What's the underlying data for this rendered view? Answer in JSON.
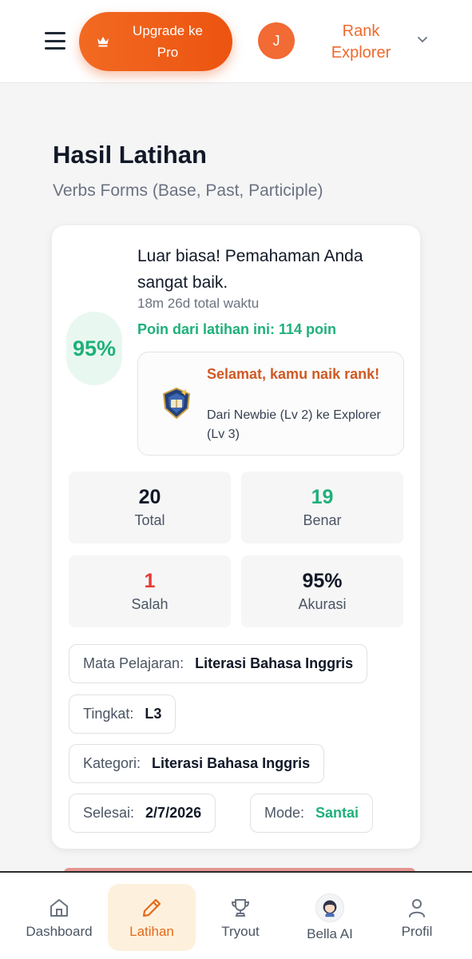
{
  "header": {
    "upgrade_label": "Upgrade ke Pro",
    "avatar_initial": "J",
    "rank_label": "Rank Explorer"
  },
  "page": {
    "title": "Hasil Latihan",
    "subtitle": "Verbs Forms (Base, Past, Participle)"
  },
  "result": {
    "score": "95%",
    "message": "Luar biasa! Pemahaman Anda sangat baik.",
    "total_time": "18m 26d total waktu",
    "points": "Poin dari latihan ini: 114 poin",
    "rankup_title": "Selamat, kamu naik rank!",
    "rankup_detail": "Dari Newbie (Lv 2) ke Explorer (Lv 3)"
  },
  "stats": [
    {
      "value": "20",
      "label": "Total",
      "color": "#111827"
    },
    {
      "value": "19",
      "label": "Benar",
      "color": "#1fb07a"
    },
    {
      "value": "1",
      "label": "Salah",
      "color": "#e53935"
    },
    {
      "value": "95%",
      "label": "Akurasi",
      "color": "#111827"
    }
  ],
  "meta": {
    "subject_key": "Mata Pelajaran:",
    "subject_val": "Literasi Bahasa Inggris",
    "level_key": "Tingkat:",
    "level_val": "L3",
    "category_key": "Kategori:",
    "category_val": "Literasi Bahasa Inggris",
    "finished_key": "Selesai:",
    "finished_val": "2/7/2026",
    "mode_key": "Mode:",
    "mode_val": "Santai"
  },
  "nav": [
    {
      "label": "Dashboard",
      "icon": "home-icon"
    },
    {
      "label": "Latihan",
      "icon": "pencil-icon",
      "active": true
    },
    {
      "label": "Tryout",
      "icon": "trophy-icon"
    },
    {
      "label": "Bella AI",
      "icon": "bella-avatar-icon"
    },
    {
      "label": "Profil",
      "icon": "user-icon"
    }
  ],
  "colors": {
    "accent": "#ec5410",
    "success": "#1fb07a",
    "danger": "#e53935"
  }
}
